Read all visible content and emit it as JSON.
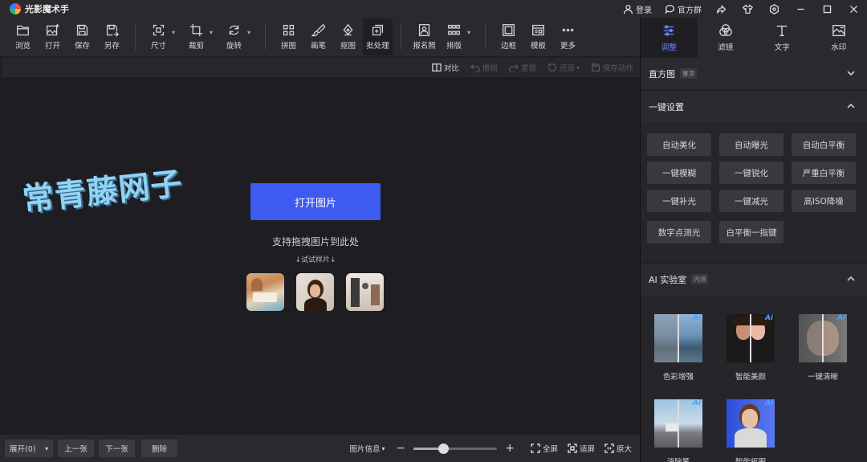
{
  "app": {
    "title": "光影魔术手"
  },
  "titlebar": {
    "login": "登录",
    "group": "官方群"
  },
  "toolbar": {
    "browse": "浏览",
    "open": "打开",
    "save": "保存",
    "saveas": "另存",
    "size": "尺寸",
    "crop": "裁剪",
    "rotate": "旋转",
    "collage": "拼图",
    "brush": "画笔",
    "cutout": "抠图",
    "batch": "批处理",
    "idphoto": "报名照",
    "layout": "排版",
    "border": "边框",
    "template": "模板",
    "more": "更多"
  },
  "subbar": {
    "compare": "对比",
    "undo": "撤销",
    "redo": "重做",
    "restore": "还原",
    "save_action": "保存动作"
  },
  "canvas": {
    "watermark": "常青藤网子",
    "open_button": "打开图片",
    "drag_hint": "支持拖拽图片到此处",
    "try_samples": "↓试试样片↓"
  },
  "bottombar": {
    "expand": "展开(0)",
    "prev": "上一张",
    "next": "下一张",
    "delete": "删除",
    "info": "图片信息",
    "zoom_level": 0.35,
    "fullscreen": "全屏",
    "fit": "适屏",
    "original": "原大"
  },
  "right_tabs": [
    {
      "label": "调整",
      "icon": "sliders-icon"
    },
    {
      "label": "滤镜",
      "icon": "filter-icon"
    },
    {
      "label": "文字",
      "icon": "text-icon"
    },
    {
      "label": "水印",
      "icon": "watermark-icon"
    }
  ],
  "histogram": {
    "title": "直方图",
    "badge": "置顶"
  },
  "one_click": {
    "title": "一键设置",
    "rows": [
      [
        "自动美化",
        "自动曝光",
        "自动白平衡"
      ],
      [
        "一键模糊",
        "一键锐化",
        "严重白平衡"
      ],
      [
        "一键补光",
        "一键减光",
        "高ISO降噪"
      ],
      [
        "数字点测光",
        "白平衡一指键"
      ]
    ]
  },
  "ai_lab": {
    "title": "AI 实验室",
    "badge": "内测",
    "items": [
      "色彩增强",
      "智能美颜",
      "一键清晰",
      "消除笔",
      "智能抠图"
    ],
    "ai_tag": "Ai"
  },
  "colors": {
    "accent": "#3d5af1",
    "tab_active": "#6a88ff"
  }
}
